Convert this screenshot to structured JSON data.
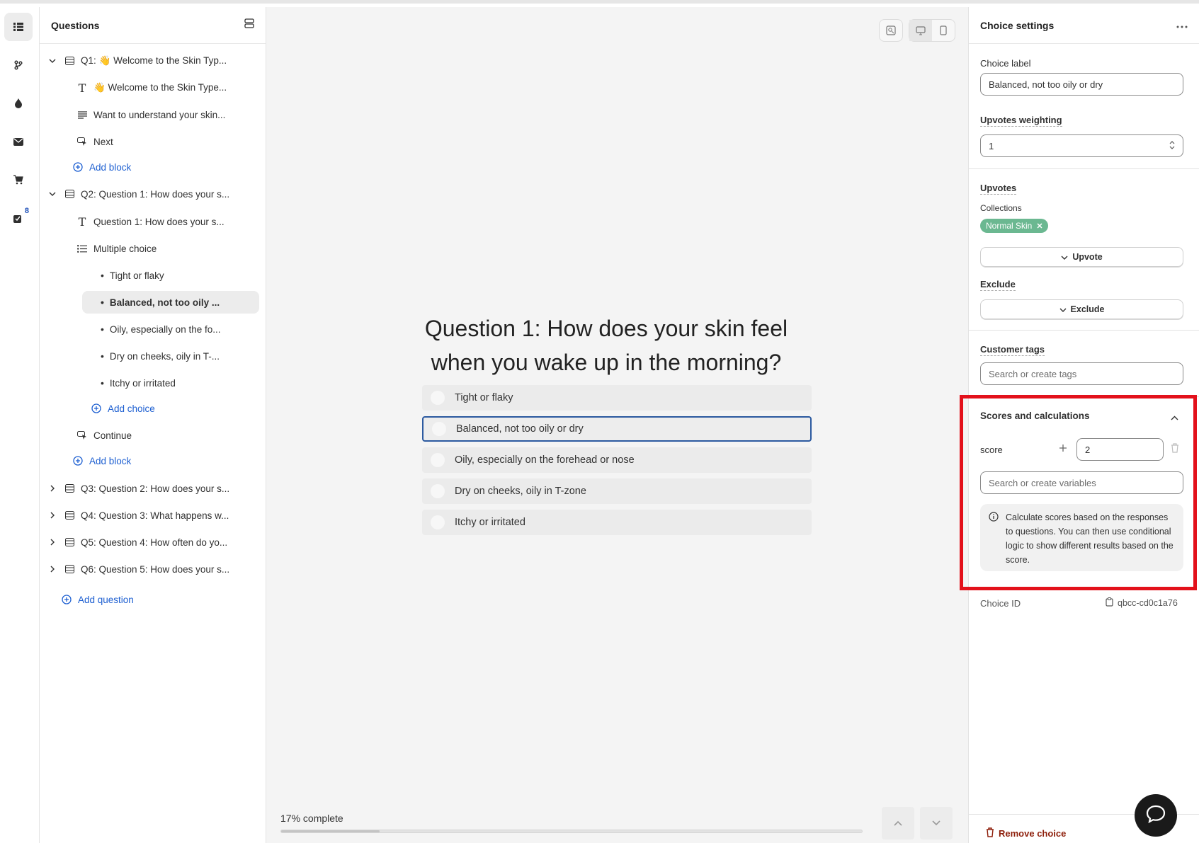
{
  "rail": {
    "badge": "8"
  },
  "questions_panel": {
    "title": "Questions",
    "q1": {
      "label": "Q1: 👋 Welcome to the Skin Typ...",
      "text": "👋 Welcome to the Skin Type...",
      "para": "Want to understand your skin...",
      "button": "Next",
      "add_block": "Add block"
    },
    "q2": {
      "label": "Q2: Question 1: How does your s...",
      "text": "Question 1: How does your s...",
      "mc": "Multiple choice",
      "choices": [
        "Tight or flaky",
        "Balanced, not too oily ...",
        "Oily, especially on the fo...",
        "Dry on cheeks, oily in T-...",
        "Itchy or irritated"
      ],
      "add_choice": "Add choice",
      "button": "Continue",
      "add_block": "Add block"
    },
    "q3": "Q3: Question 2: How does your s...",
    "q4": "Q4: Question 3: What happens w...",
    "q5": "Q5: Question 4: How often do yo...",
    "q6": "Q6: Question 5: How does your s...",
    "add_question": "Add question"
  },
  "preview": {
    "question": "Question 1: How does your skin feel when you wake up in the morning?",
    "choices": [
      "Tight or flaky",
      "Balanced, not too oily or dry",
      "Oily, especially on the forehead or nose",
      "Dry on cheeks, oily in T-zone",
      "Itchy or irritated"
    ],
    "progress_label": "17% complete",
    "progress": 0.17
  },
  "settings": {
    "title": "Choice settings",
    "choice_label_title": "Choice label",
    "choice_label_value": "Balanced, not too oily or dry",
    "upvotes_weighting_title": "Upvotes weighting",
    "upvotes_weighting_value": "1",
    "upvotes_title": "Upvotes",
    "collections_label": "Collections",
    "collection_tag": "Normal Skin",
    "upvote_button": "Upvote",
    "exclude_title": "Exclude",
    "exclude_button": "Exclude",
    "customer_tags_title": "Customer tags",
    "customer_tags_placeholder": "Search or create tags",
    "scores_title": "Scores and calculations",
    "score_name": "score",
    "score_value": "2",
    "variables_placeholder": "Search or create variables",
    "info_text": "Calculate scores based on the responses to questions. You can then use conditional logic to show different results based on the score.",
    "choice_id_label": "Choice ID",
    "choice_id_value": "qbcc-cd0c1a76",
    "remove_choice": "Remove choice"
  },
  "colors": {
    "accent_link": "#1d5fd1",
    "highlight": "#e3111b",
    "tag": "#6bb891",
    "danger": "#8e1f0b"
  }
}
